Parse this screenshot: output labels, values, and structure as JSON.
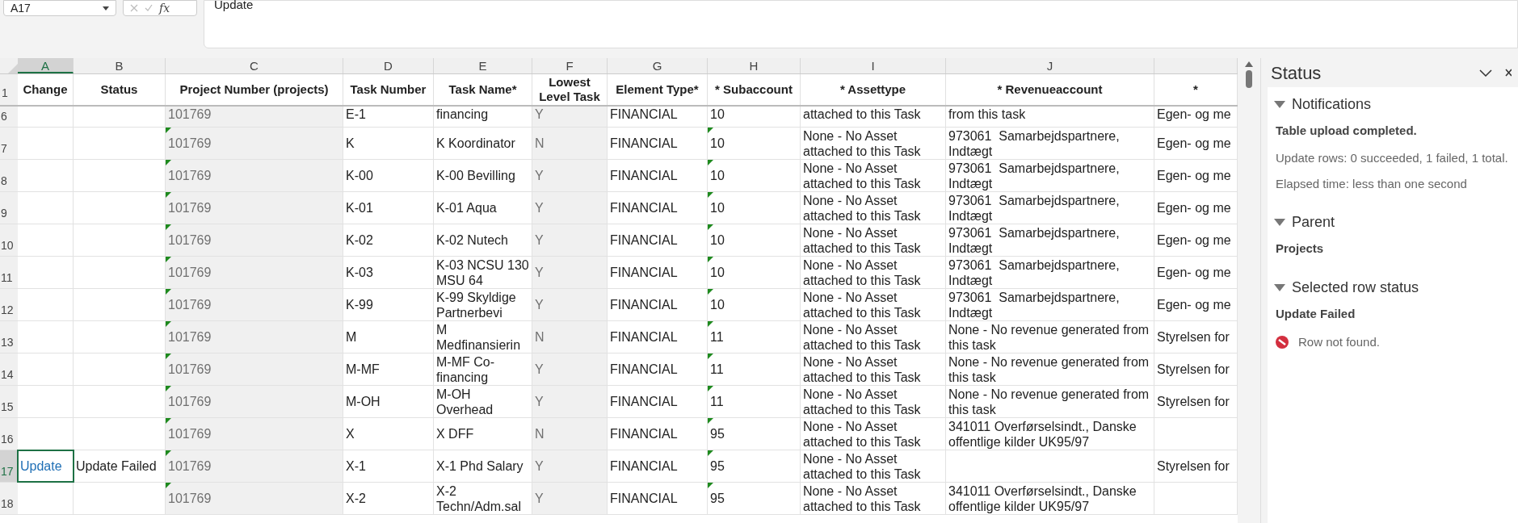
{
  "formula_bar": {
    "name_box": "A17",
    "fx_label": "fx",
    "value": "Update"
  },
  "columns": [
    {
      "letter": "A",
      "heading": "Change",
      "kind": "action",
      "selected": true
    },
    {
      "letter": "B",
      "heading": "Status",
      "kind": "normal",
      "selected": false
    },
    {
      "letter": "C",
      "heading": "Project Number (projects)",
      "kind": "readonly",
      "selected": false
    },
    {
      "letter": "D",
      "heading": "Task Number",
      "kind": "normal",
      "selected": false
    },
    {
      "letter": "E",
      "heading": "Task Name*",
      "kind": "normal",
      "selected": false
    },
    {
      "letter": "F",
      "heading": "Lowest Level Task",
      "kind": "readonly",
      "selected": false
    },
    {
      "letter": "G",
      "heading": "Element Type*",
      "kind": "normal",
      "selected": false
    },
    {
      "letter": "H",
      "heading": "* Subaccount",
      "kind": "normal",
      "selected": false
    },
    {
      "letter": "I",
      "heading": "* Assettype",
      "kind": "normal",
      "selected": false
    },
    {
      "letter": "J",
      "heading": "* Revenueaccount",
      "kind": "normal",
      "selected": false
    },
    {
      "heading": "*",
      "kind": "normal",
      "selected": false
    }
  ],
  "header_row_number": "1",
  "rows": [
    {
      "number": "6",
      "kind": "cut",
      "selected": false,
      "flagged": false,
      "cells": [
        "",
        "",
        "101769",
        "E-1",
        "financing",
        "Y",
        "FINANCIAL",
        "10",
        "attached to this Task",
        "from this task",
        "Egen- og me"
      ]
    },
    {
      "number": "7",
      "kind": "full",
      "selected": false,
      "flagged": true,
      "cells": [
        "",
        "",
        "101769",
        "K",
        "K Koordinator",
        "N",
        "FINANCIAL",
        "10",
        "None - No Asset attached to this Task",
        "973061  Samarbejdspartnere, Indtægt",
        "Egen- og me"
      ]
    },
    {
      "number": "8",
      "kind": "full",
      "selected": false,
      "flagged": true,
      "cells": [
        "",
        "",
        "101769",
        "K-00",
        "K-00 Bevilling",
        "Y",
        "FINANCIAL",
        "10",
        "None - No Asset attached to this Task",
        "973061  Samarbejdspartnere, Indtægt",
        "Egen- og me"
      ]
    },
    {
      "number": "9",
      "kind": "full",
      "selected": false,
      "flagged": true,
      "cells": [
        "",
        "",
        "101769",
        "K-01",
        "K-01 Aqua",
        "Y",
        "FINANCIAL",
        "10",
        "None - No Asset attached to this Task",
        "973061  Samarbejdspartnere, Indtægt",
        "Egen- og me"
      ]
    },
    {
      "number": "10",
      "kind": "full",
      "selected": false,
      "flagged": true,
      "cells": [
        "",
        "",
        "101769",
        "K-02",
        "K-02 Nutech",
        "Y",
        "FINANCIAL",
        "10",
        "None - No Asset attached to this Task",
        "973061  Samarbejdspartnere, Indtægt",
        "Egen- og me"
      ]
    },
    {
      "number": "11",
      "kind": "full",
      "selected": false,
      "flagged": true,
      "cells": [
        "",
        "",
        "101769",
        "K-03",
        "K-03 NCSU 130 MSU 64",
        "Y",
        "FINANCIAL",
        "10",
        "None - No Asset attached to this Task",
        "973061  Samarbejdspartnere, Indtægt",
        "Egen- og me"
      ]
    },
    {
      "number": "12",
      "kind": "full",
      "selected": false,
      "flagged": true,
      "cells": [
        "",
        "",
        "101769",
        "K-99",
        "K-99 Skyldige Partnerbevi",
        "Y",
        "FINANCIAL",
        "10",
        "None - No Asset attached to this Task",
        "973061  Samarbejdspartnere, Indtægt",
        "Egen- og me"
      ]
    },
    {
      "number": "13",
      "kind": "full",
      "selected": false,
      "flagged": true,
      "cells": [
        "",
        "",
        "101769",
        "M",
        "M Medfinansierin",
        "N",
        "FINANCIAL",
        "11",
        "None - No Asset attached to this Task",
        "None - No revenue generated from this task",
        "Styrelsen for"
      ]
    },
    {
      "number": "14",
      "kind": "full",
      "selected": false,
      "flagged": true,
      "cells": [
        "",
        "",
        "101769",
        "M-MF",
        "M-MF Co-financing",
        "Y",
        "FINANCIAL",
        "11",
        "None - No Asset attached to this Task",
        "None - No revenue generated from this task",
        "Styrelsen for"
      ]
    },
    {
      "number": "15",
      "kind": "full",
      "selected": false,
      "flagged": true,
      "cells": [
        "",
        "",
        "101769",
        "M-OH",
        "M-OH Overhead",
        "Y",
        "FINANCIAL",
        "11",
        "None - No Asset attached to this Task",
        "None - No revenue generated from this task",
        "Styrelsen for"
      ]
    },
    {
      "number": "16",
      "kind": "full",
      "selected": false,
      "flagged": true,
      "cells": [
        "",
        "",
        "101769",
        "X",
        "X DFF",
        "N",
        "FINANCIAL",
        "95",
        "None - No Asset attached to this Task",
        "341011 Overførselsindt., Danske offentlige kilder UK95/97",
        ""
      ]
    },
    {
      "number": "17",
      "kind": "full",
      "selected": true,
      "flagged": true,
      "cells": [
        "Update",
        "Update Failed",
        "101769",
        "X-1",
        "X-1 Phd Salary",
        "Y",
        "FINANCIAL",
        "95",
        "None - No Asset attached to this Task",
        "",
        "Styrelsen for"
      ]
    },
    {
      "number": "18",
      "kind": "full",
      "selected": false,
      "flagged": true,
      "cells": [
        "",
        "",
        "101769",
        "X-2",
        "X-2 Techn/Adm.sal",
        "Y",
        "FINANCIAL",
        "95",
        "None - No Asset attached to this Task",
        "341011 Overførselsindt., Danske offentlige kilder UK95/97",
        ""
      ]
    }
  ],
  "status_panel": {
    "title": "Status",
    "sections": [
      {
        "title": "Notifications",
        "expanded": true,
        "items": [
          {
            "kind": "bold",
            "text": "Table upload completed."
          },
          {
            "kind": "plain",
            "text": "Update rows:  0 succeeded, 1 failed, 1 total."
          },
          {
            "kind": "plain",
            "text": "Elapsed time: less than one second"
          }
        ]
      },
      {
        "title": "Parent",
        "expanded": true,
        "items": [
          {
            "kind": "bold",
            "text": "Projects"
          }
        ]
      },
      {
        "title": "Selected row status",
        "expanded": true,
        "items": [
          {
            "kind": "bold",
            "text": "Update Failed"
          },
          {
            "kind": "error",
            "text": "Row not found."
          }
        ]
      }
    ]
  }
}
